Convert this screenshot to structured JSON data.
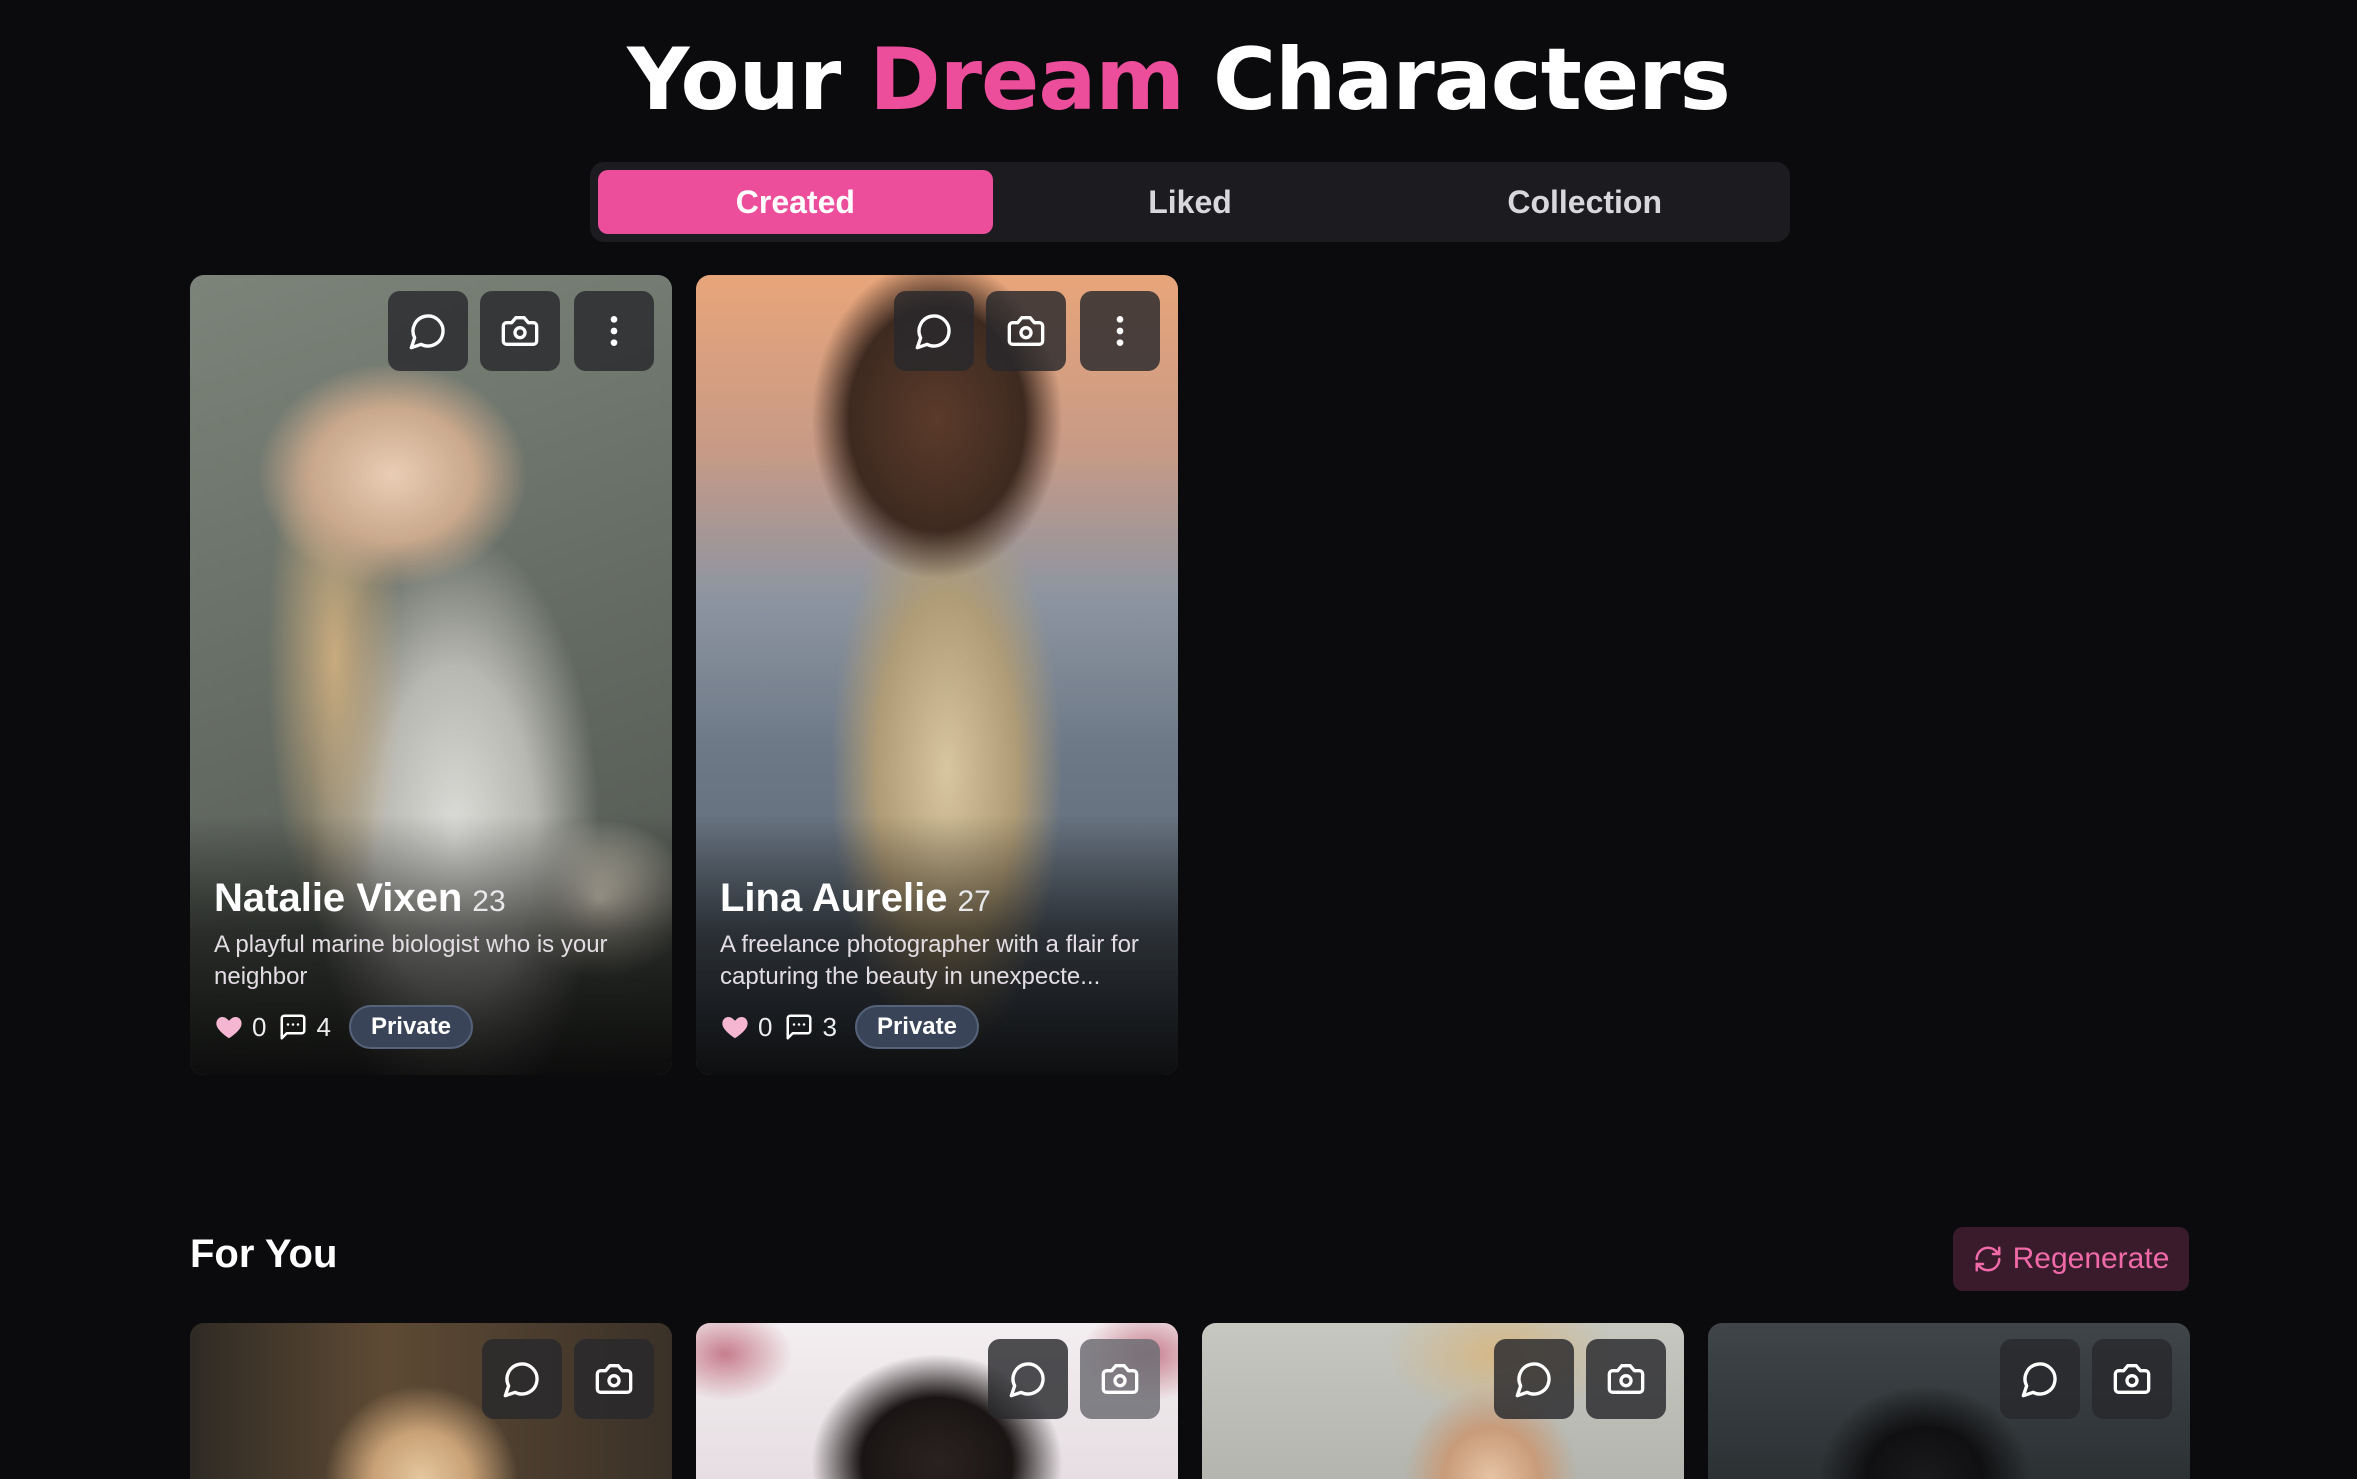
{
  "header": {
    "title_part1": "Your",
    "title_accent": "Dream",
    "title_part2": "Characters"
  },
  "tabs": [
    {
      "label": "Created",
      "active": true
    },
    {
      "label": "Liked",
      "active": false
    },
    {
      "label": "Collection",
      "active": false
    }
  ],
  "created": [
    {
      "name": "Natalie Vixen",
      "age": "23",
      "description": "A playful marine biologist who is your neighbor",
      "likes": "0",
      "comments": "4",
      "visibility": "Private"
    },
    {
      "name": "Lina Aurelie",
      "age": "27",
      "description": "A freelance photographer with a flair for capturing the beauty in unexpecte...",
      "likes": "0",
      "comments": "3",
      "visibility": "Private"
    }
  ],
  "for_you": {
    "title": "For You",
    "regenerate_label": "Regenerate"
  },
  "colors": {
    "accent": "#ec4e9c",
    "background": "#0b0b0d",
    "badge": "#3a4458"
  }
}
